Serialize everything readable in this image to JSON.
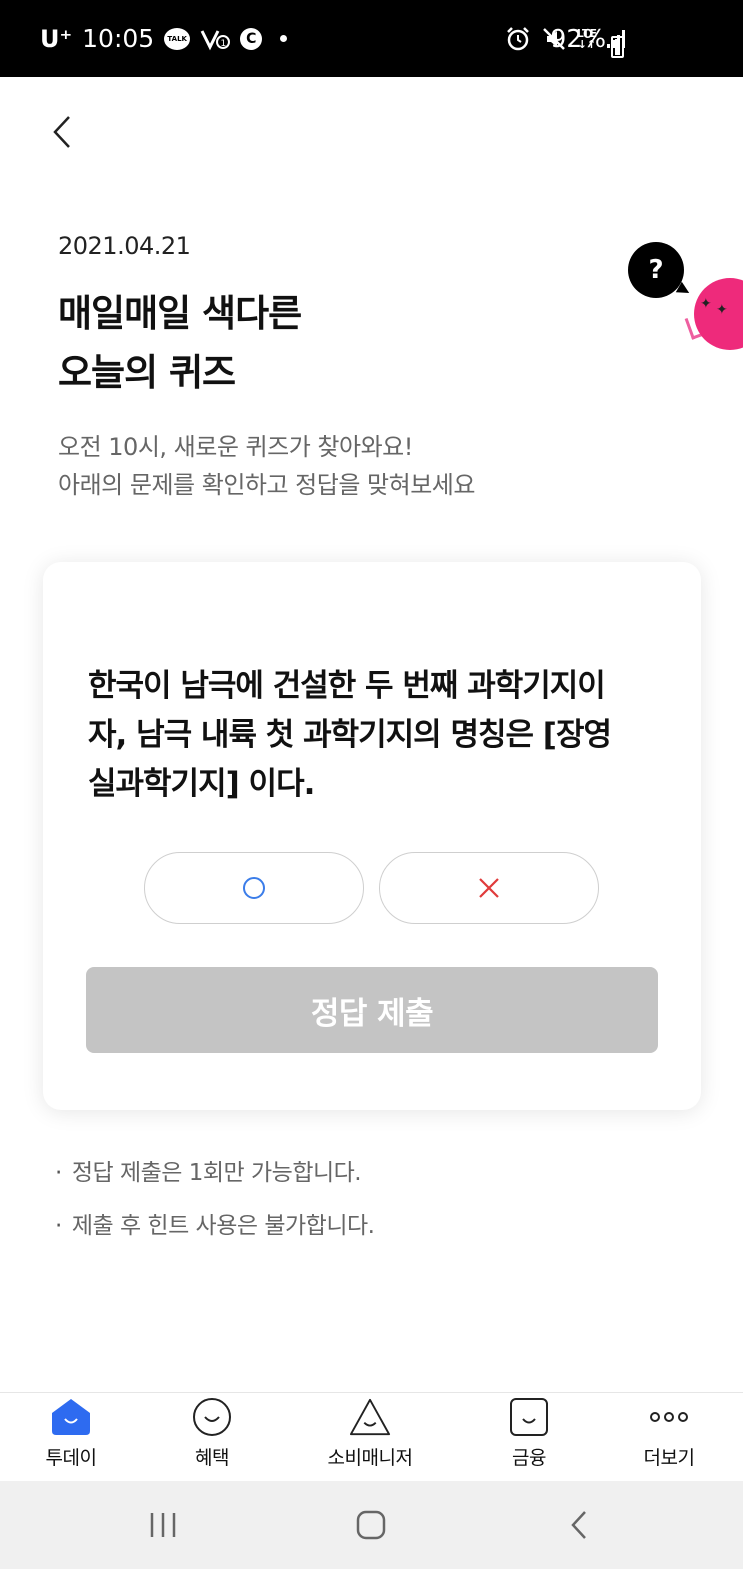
{
  "status_bar": {
    "carrier": "U⁺",
    "time": "10:05",
    "talk_icon_text": "TALK",
    "battery": "92%",
    "lte": "LTE"
  },
  "header": {
    "date": "2021.04.21",
    "title_line1": "매일매일 색다른",
    "title_line2": "오늘의 퀴즈",
    "desc_line1": "오전 10시, 새로운 퀴즈가 찾아와요!",
    "desc_line2": "아래의 문제를 확인하고 정답을 맞혀보세요",
    "help_label": "?"
  },
  "quiz": {
    "question_line1": "한국이 남극에 건설한 두 번째 과학기지이",
    "question_line2": "자, 남극 내륙 첫 과학기지의 명칭은 [장영",
    "question_line3": "실과학기지] 이다.",
    "submit_label": "정답 제출",
    "colors": {
      "o": "#3b7de9",
      "x": "#e03b3b",
      "submit_bg": "#c4c4c4",
      "accent": "#2e6bf0",
      "mascot": "#ee2a7b"
    }
  },
  "notes": [
    "정답 제출은 1회만 가능합니다.",
    "제출 후 힌트 사용은 불가합니다."
  ],
  "bottom_nav": {
    "items": [
      {
        "label": "투데이",
        "icon": "home-smile-icon",
        "active": true
      },
      {
        "label": "혜택",
        "icon": "smile-circle-icon",
        "active": false
      },
      {
        "label": "소비매니저",
        "icon": "triangle-smile-icon",
        "active": false
      },
      {
        "label": "금융",
        "icon": "square-smile-icon",
        "active": false
      },
      {
        "label": "더보기",
        "icon": "more-dots-icon",
        "active": false
      }
    ]
  }
}
